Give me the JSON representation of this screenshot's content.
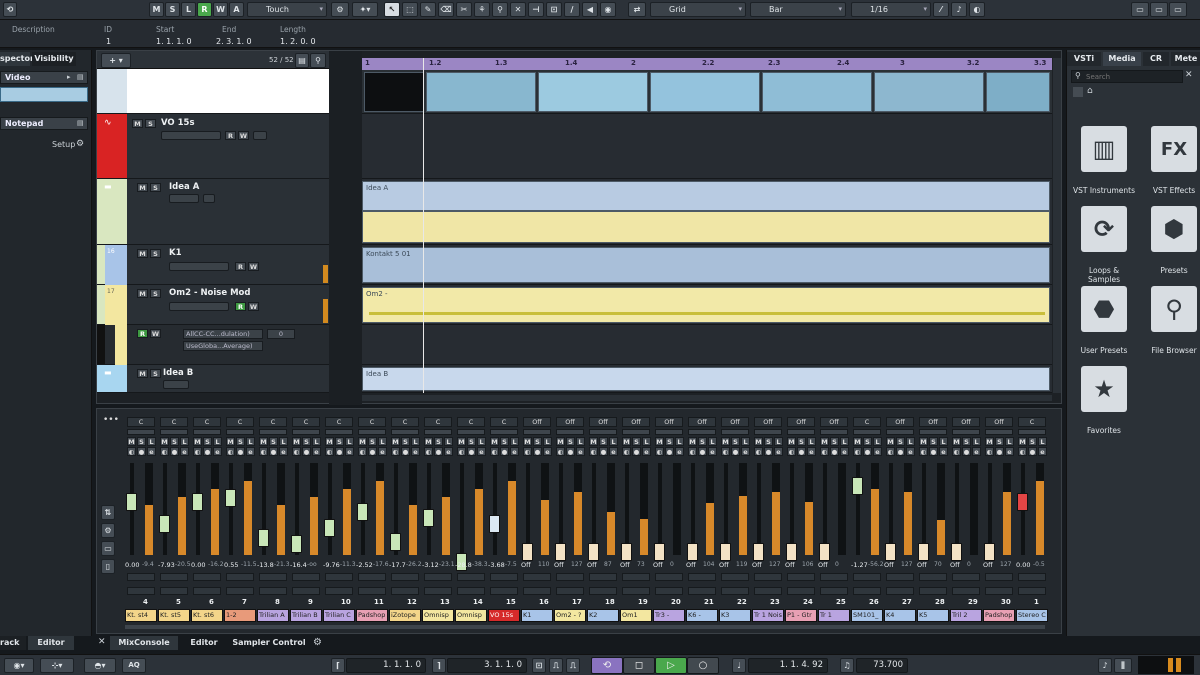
{
  "toolbar": {
    "mode_buttons": [
      "M",
      "S",
      "L",
      "R",
      "W",
      "A"
    ],
    "automation_mode": "Touch",
    "snap_type": "Grid",
    "grid_type": "Bar",
    "quantize": "1/16"
  },
  "infoline": {
    "labels": [
      "Description",
      "ID",
      "Start",
      "End",
      "Length"
    ],
    "values": [
      "1",
      "1. 1. 1. 0",
      "2. 3. 1. 0",
      "1. 2. 0. 0"
    ]
  },
  "inspector": {
    "tabs": [
      "spector",
      "Visibility"
    ],
    "video_label": "Video",
    "notepad_label": "Notepad",
    "setup_label": "Setup"
  },
  "project": {
    "track_count": "52 / 52",
    "ruler_marks": [
      "1",
      "1.2",
      "1.3",
      "1.4",
      "2",
      "2.2",
      "2.3",
      "2.4",
      "3",
      "3.2",
      "3.3"
    ],
    "tracks": [
      {
        "name": "VO 15s"
      },
      {
        "name": "Idea A"
      },
      {
        "name": "K1",
        "number": "16"
      },
      {
        "name": "Om2 - Noise Mod",
        "number": "17"
      },
      {
        "name": "Idea B"
      }
    ],
    "auto_lane": {
      "param": "AllCC-CC...dulation)",
      "value": "0",
      "mode": "UseGloba...Average)"
    },
    "events": {
      "idea_a": "Idea A",
      "kontakt": "Kontakt 5 01",
      "om2": "Om2 -",
      "idea_b": "Idea B"
    }
  },
  "right_zone": {
    "tabs": [
      "VSTi",
      "Media",
      "CR",
      "Mete"
    ],
    "search_placeholder": "Search",
    "tiles": [
      {
        "label": "VST Instruments",
        "icon": "piano-keys-icon"
      },
      {
        "label": "VST Effects",
        "icon": "fx-icon"
      },
      {
        "label": "Loops & Samples",
        "icon": "loop-icon"
      },
      {
        "label": "Presets",
        "icon": "hexagons-icon"
      },
      {
        "label": "User Presets",
        "icon": "user-hexagon-icon"
      },
      {
        "label": "File Browser",
        "icon": "file-browser-icon"
      },
      {
        "label": "Favorites",
        "icon": "star-icon"
      }
    ]
  },
  "mixer": {
    "channels": [
      {
        "num": "4",
        "name": "Kt. st4",
        "color": "#f3d58a",
        "v1": "0.00",
        "v2": "-9.4"
      },
      {
        "num": "5",
        "name": "Kt. st5",
        "color": "#f3d58a",
        "v1": "-7.93",
        "v2": "-20.5"
      },
      {
        "num": "6",
        "name": "Kt. st6",
        "color": "#f3d58a",
        "v1": "0.00",
        "v2": "-16.2"
      },
      {
        "num": "7",
        "name": "1-2",
        "color": "#e89a7a",
        "v1": "0.55",
        "v2": "-11.5"
      },
      {
        "num": "8",
        "name": "Trilian A",
        "color": "#b9a4e0",
        "v1": "-13.8",
        "v2": "-21.3"
      },
      {
        "num": "9",
        "name": "Trilian B",
        "color": "#b9a4e0",
        "v1": "-16.4",
        "v2": "-oo"
      },
      {
        "num": "10",
        "name": "Trilian C",
        "color": "#b9a4e0",
        "v1": "-9.76",
        "v2": "-11.3"
      },
      {
        "num": "11",
        "name": "Padshop",
        "color": "#e8a0b4",
        "v1": "-2.52",
        "v2": "-17.6"
      },
      {
        "num": "12",
        "name": "iZotope",
        "color": "#f3d58a",
        "v1": "-17.7",
        "v2": "-26.2"
      },
      {
        "num": "13",
        "name": "Omnisp",
        "color": "#f3e7a0",
        "v1": "-3.12",
        "v2": "-23.1"
      },
      {
        "num": "14",
        "name": "Omnisp",
        "color": "#f3e7a0",
        "v1": "-28.8",
        "v2": "-38.3"
      },
      {
        "num": "15",
        "name": "VO 15s",
        "color": "#d62a2a",
        "v1": "-3.68",
        "v2": "-7.5"
      },
      {
        "num": "16",
        "name": "K1",
        "color": "#a8c4e8",
        "v1": "Off",
        "v2": "110"
      },
      {
        "num": "17",
        "name": "Om2 - ?",
        "color": "#f3e7a0",
        "v1": "Off",
        "v2": "127"
      },
      {
        "num": "18",
        "name": "K2",
        "color": "#a8c4e8",
        "v1": "Off",
        "v2": "87"
      },
      {
        "num": "19",
        "name": "Om1",
        "color": "#f3e7a0",
        "v1": "Off",
        "v2": "73"
      },
      {
        "num": "20",
        "name": "Tr3 -",
        "color": "#b9a4e0",
        "v1": "Off",
        "v2": "0"
      },
      {
        "num": "21",
        "name": "K6 -",
        "color": "#a8c4e8",
        "v1": "Off",
        "v2": "104"
      },
      {
        "num": "22",
        "name": "K3",
        "color": "#a8c4e8",
        "v1": "Off",
        "v2": "119"
      },
      {
        "num": "23",
        "name": "Tr 1 Nois",
        "color": "#b9a4e0",
        "v1": "Off",
        "v2": "127"
      },
      {
        "num": "24",
        "name": "P1 - Gtr",
        "color": "#e8a0b4",
        "v1": "Off",
        "v2": "106"
      },
      {
        "num": "25",
        "name": "Tr 1",
        "color": "#b9a4e0",
        "v1": "Off",
        "v2": "0"
      },
      {
        "num": "26",
        "name": "SM101_",
        "color": "#a8c4e8",
        "v1": "-1.27",
        "v2": "-56.2"
      },
      {
        "num": "27",
        "name": "K4",
        "color": "#a8c4e8",
        "v1": "Off",
        "v2": "127"
      },
      {
        "num": "28",
        "name": "K5",
        "color": "#a8c4e8",
        "v1": "Off",
        "v2": "70"
      },
      {
        "num": "29",
        "name": "Tril 2",
        "color": "#b9a4e0",
        "v1": "Off",
        "v2": "0"
      },
      {
        "num": "30",
        "name": "Padshop",
        "color": "#e8a0b4",
        "v1": "Off",
        "v2": "127"
      },
      {
        "num": "1",
        "name": "Stereo C",
        "color": "#a8c4e8",
        "v1": "0.00",
        "v2": "-0.5"
      }
    ],
    "pan_label": "C",
    "off_label": "Off"
  },
  "bottom_tabs": {
    "left": [
      "rack",
      "Editor"
    ],
    "right": [
      "MixConsole",
      "Editor",
      "Sampler Control"
    ]
  },
  "transport": {
    "left_locator": "1. 1. 1. 0",
    "right_locator": "3. 1. 1. 0",
    "position": "1. 1. 4. 92",
    "tempo": "73.700",
    "aq": "AQ"
  }
}
